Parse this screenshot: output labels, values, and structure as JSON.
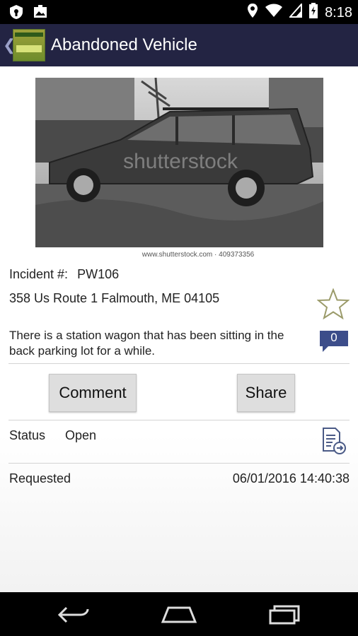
{
  "status_bar": {
    "time": "8:18"
  },
  "app_bar": {
    "title": "Abandoned Vehicle"
  },
  "photo": {
    "watermark": "shutterstock",
    "caption": "www.shutterstock.com · 409373356"
  },
  "incident": {
    "label": "Incident #:",
    "number": "PW106",
    "address": "358 Us Route 1 Falmouth, ME 04105",
    "description": "There is a station wagon that has been sitting in the back parking lot for a while.",
    "comment_count": "0"
  },
  "actions": {
    "comment_label": "Comment",
    "share_label": "Share"
  },
  "status": {
    "label": "Status",
    "value": "Open"
  },
  "requested": {
    "label": "Requested",
    "value": "06/01/2016 14:40:38"
  },
  "colors": {
    "app_bar": "#232443",
    "accent_badge": "#3c4d8a",
    "star": "#9b9b6a"
  }
}
